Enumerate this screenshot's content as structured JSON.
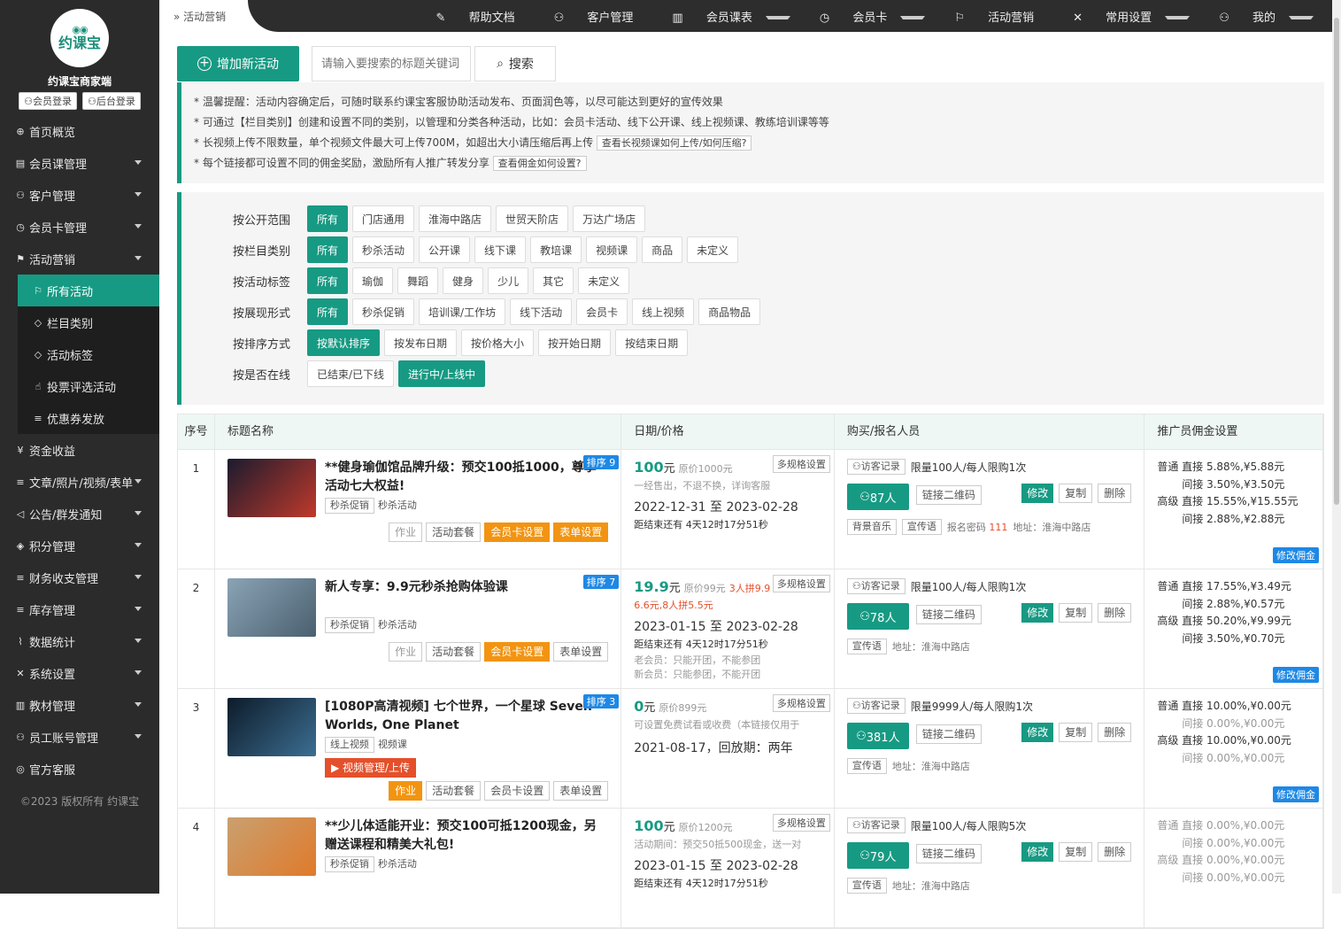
{
  "sidebar": {
    "logo_text": "约课宝",
    "brand": "约课宝商家端",
    "member_login": "会员登录",
    "admin_login": "后台登录",
    "menu": [
      {
        "label": "首页概览",
        "icon": "globe-icon",
        "glyph": "⊕",
        "caret": false
      },
      {
        "label": "会员课管理",
        "icon": "document-icon",
        "glyph": "▤",
        "caret": true
      },
      {
        "label": "客户管理",
        "icon": "user-icon",
        "glyph": "⚇",
        "caret": true
      },
      {
        "label": "会员卡管理",
        "icon": "clock-icon",
        "glyph": "◷",
        "caret": true
      },
      {
        "label": "活动营销",
        "icon": "flag-icon",
        "glyph": "⚑",
        "caret": true
      }
    ],
    "submenu": [
      {
        "label": "所有活动",
        "icon": "flag-icon",
        "glyph": "⚐",
        "active": true
      },
      {
        "label": "栏目类别",
        "icon": "tag-icon",
        "glyph": "◇",
        "active": false
      },
      {
        "label": "活动标签",
        "icon": "tag-icon",
        "glyph": "◇",
        "active": false
      },
      {
        "label": "投票评选活动",
        "icon": "thumb-icon",
        "glyph": "☝",
        "active": false
      },
      {
        "label": "优惠券发放",
        "icon": "sliders-icon",
        "glyph": "≡",
        "active": false
      }
    ],
    "menu2": [
      {
        "label": "资金收益",
        "icon": "yen-icon",
        "glyph": "¥",
        "caret": false
      },
      {
        "label": "文章/照片/视频/表单",
        "icon": "sliders-icon",
        "glyph": "≡",
        "caret": true
      },
      {
        "label": "公告/群发通知",
        "icon": "speaker-icon",
        "glyph": "◁",
        "caret": true
      },
      {
        "label": "积分管理",
        "icon": "diamond-icon",
        "glyph": "◈",
        "caret": true
      },
      {
        "label": "财务收支管理",
        "icon": "sliders-icon",
        "glyph": "≡",
        "caret": true
      },
      {
        "label": "库存管理",
        "icon": "sliders-icon",
        "glyph": "≡",
        "caret": true
      },
      {
        "label": "数据统计",
        "icon": "pulse-icon",
        "glyph": "⌇",
        "caret": true
      },
      {
        "label": "系统设置",
        "icon": "tools-icon",
        "glyph": "✕",
        "caret": true
      },
      {
        "label": "教材管理",
        "icon": "book-icon",
        "glyph": "▥",
        "caret": true
      },
      {
        "label": "员工账号管理",
        "icon": "user-icon",
        "glyph": "⚇",
        "caret": true
      },
      {
        "label": "官方客服",
        "icon": "shield-icon",
        "glyph": "◎",
        "caret": false
      }
    ],
    "copyright": "©2023 版权所有 约课宝"
  },
  "topbar": {
    "breadcrumb": "活动营销",
    "nav": [
      {
        "label": "帮助文档",
        "icon": "help-icon",
        "glyph": "✎",
        "help": true,
        "caret": false
      },
      {
        "label": "客户管理",
        "icon": "user-icon",
        "glyph": "⚇",
        "help": false,
        "caret": false
      },
      {
        "label": "会员课表",
        "icon": "book-icon",
        "glyph": "▥",
        "help": false,
        "caret": true
      },
      {
        "label": "会员卡",
        "icon": "clock-icon",
        "glyph": "◷",
        "help": false,
        "caret": true
      },
      {
        "label": "活动营销",
        "icon": "flag-icon",
        "glyph": "⚐",
        "help": false,
        "caret": false
      },
      {
        "label": "常用设置",
        "icon": "tools-icon",
        "glyph": "✕",
        "help": false,
        "caret": true
      },
      {
        "label": "我的",
        "icon": "user-icon",
        "glyph": "⚇",
        "help": false,
        "caret": true
      }
    ]
  },
  "toolbar": {
    "add_label": "增加新活动",
    "search_placeholder": "请输入要搜索的标题关键词",
    "search_label": "搜索"
  },
  "notice": {
    "lines": [
      {
        "text": "* 温馨提醒：活动内容确定后，可随时联系约课宝客服协助活动发布、页面润色等，以尽可能达到更好的宣传效果",
        "link": ""
      },
      {
        "text": "* 可通过【栏目类别】创建和设置不同的类别，以管理和分类各种活动，比如：会员卡活动、线下公开课、线上视频课、教练培训课等等",
        "link": ""
      },
      {
        "text": "* 长视频上传不限数量，单个视频文件最大可上传700M，如超出大小请压缩后再上传",
        "link": "查看长视频课如何上传/如何压缩?"
      },
      {
        "text": "* 每个链接都可设置不同的佣金奖励，激励所有人推广转发分享",
        "link": "查看佣金如何设置?"
      }
    ]
  },
  "filters": [
    {
      "label": "按公开范围",
      "options": [
        "所有",
        "门店通用",
        "淮海中路店",
        "世贸天阶店",
        "万达广场店"
      ],
      "active": 0
    },
    {
      "label": "按栏目类别",
      "options": [
        "所有",
        "秒杀活动",
        "公开课",
        "线下课",
        "教培课",
        "视频课",
        "商品",
        "未定义"
      ],
      "active": 0
    },
    {
      "label": "按活动标签",
      "options": [
        "所有",
        "瑜伽",
        "舞蹈",
        "健身",
        "少儿",
        "其它",
        "未定义"
      ],
      "active": 0
    },
    {
      "label": "按展现形式",
      "options": [
        "所有",
        "秒杀促销",
        "培训课/工作坊",
        "线下活动",
        "会员卡",
        "线上视频",
        "商品物品"
      ],
      "active": 0
    },
    {
      "label": "按排序方式",
      "options": [
        "按默认排序",
        "按发布日期",
        "按价格大小",
        "按开始日期",
        "按结束日期"
      ],
      "active": 0
    },
    {
      "label": "按是否在线",
      "options": [
        "已结束/已下线",
        "进行中/上线中"
      ],
      "active": 1
    }
  ],
  "table": {
    "headers": [
      "序号",
      "标题名称",
      "日期/价格",
      "购买/报名人员",
      "推广员佣金设置"
    ],
    "spec_label": "多规格设置",
    "visitor_label": "访客记录",
    "qr_label": "链接二维码",
    "edit_label": "修改",
    "copy_label": "复制",
    "delete_label": "删除",
    "mod_comm_label": "修改佣金",
    "rows": [
      {
        "no": "1",
        "title": "**健身瑜伽馆品牌升级：预交100抵1000，尊享活动七大权益!",
        "rank": "排序 9",
        "thumb": [
          "#1b1b2e",
          "#c0392b"
        ],
        "tags": [
          "秒杀促销"
        ],
        "plain": "秒杀活动",
        "video_btn": "",
        "ops": [
          {
            "l": "作业",
            "t": "gray"
          },
          {
            "l": "活动套餐",
            "t": ""
          },
          {
            "l": "会员卡设置",
            "t": "org"
          },
          {
            "l": "表单设置",
            "t": "org"
          }
        ],
        "price": "100",
        "unit": "元",
        "orig": "原价1000元",
        "promo": "",
        "sub": "一经售出，不退不换，详询客服",
        "dates": "2022-12-31 至 2023-02-28",
        "countdown": "距结束还有 4天12时17分51秒",
        "note1": "",
        "note2": "",
        "limit": "限量100人/每人限购1次",
        "people": "87人",
        "extra": [
          "背景音乐",
          "宣传语"
        ],
        "pwd_label": "报名密码",
        "pwd": "111",
        "addr": "地址：淮海中路店",
        "comm": {
          "l1": "普通 直接 5.88%,¥5.88元",
          "l2": "间接 3.50%,¥3.50元",
          "l3": "高级 直接 15.55%,¥15.55元",
          "l4": "间接 2.88%,¥2.88元"
        }
      },
      {
        "no": "2",
        "title": "新人专享：9.9元秒杀抢购体验课",
        "rank": "排序 7",
        "thumb": [
          "#8aa3b5",
          "#4a6070"
        ],
        "tags": [
          "秒杀促销"
        ],
        "plain": "秒杀活动",
        "video_btn": "",
        "ops": [
          {
            "l": "作业",
            "t": "gray"
          },
          {
            "l": "活动套餐",
            "t": ""
          },
          {
            "l": "会员卡设置",
            "t": "org"
          },
          {
            "l": "表单设置",
            "t": ""
          }
        ],
        "price": "19.9",
        "unit": "元",
        "orig": "原价99元",
        "promo": "3人拼9.9",
        "sub": "6.6元,8人拼5.5元",
        "dates": "2023-01-15 至 2023-02-28",
        "countdown": "距结束还有 4天12时17分51秒",
        "note1": "老会员：只能开团，不能参团",
        "note2": "新会员：只能参团，不能开团",
        "limit": "限量100人/每人限购1次",
        "people": "78人",
        "extra": [
          "宣传语"
        ],
        "pwd_label": "",
        "pwd": "",
        "addr": "地址：淮海中路店",
        "comm": {
          "l1": "普通 直接 17.55%,¥3.49元",
          "l2": "间接 2.88%,¥0.57元",
          "l3": "高级 直接 50.20%,¥9.99元",
          "l4": "间接 3.50%,¥0.70元"
        }
      },
      {
        "no": "3",
        "title": "[1080P高清视频] 七个世界，一个星球 Seven Worlds, One Planet",
        "rank": "排序 3",
        "thumb": [
          "#0d1b2a",
          "#3c6e91"
        ],
        "tags": [
          "线上视频"
        ],
        "plain": "视频课",
        "video_btn": "视频管理/上传",
        "ops": [
          {
            "l": "作业",
            "t": "org"
          },
          {
            "l": "活动套餐",
            "t": ""
          },
          {
            "l": "会员卡设置",
            "t": ""
          },
          {
            "l": "表单设置",
            "t": ""
          }
        ],
        "price": "0",
        "unit": "元",
        "orig": "原价899元",
        "promo": "",
        "sub": "可设置免费试看或收费（本链接仅用于",
        "dates": "2021-08-17，回放期：两年",
        "countdown": "",
        "note1": "",
        "note2": "",
        "limit": "限量9999人/每人限购1次",
        "people": "381人",
        "extra": [
          "宣传语"
        ],
        "pwd_label": "",
        "pwd": "",
        "addr": "地址：淮海中路店",
        "comm": {
          "l1": "普通 直接 10.00%,¥0.00元",
          "l2": "间接 0.00%,¥0.00元",
          "l3": "高级 直接 10.00%,¥0.00元",
          "l4": "间接 0.00%,¥0.00元"
        }
      },
      {
        "no": "4",
        "title": "**少儿体适能开业：预交100可抵1200现金，另赠送课程和精美大礼包!",
        "rank": "",
        "thumb": [
          "#c9a070",
          "#e07a2a"
        ],
        "tags": [
          "秒杀促销"
        ],
        "plain": "秒杀活动",
        "video_btn": "",
        "ops": [],
        "price": "100",
        "unit": "元",
        "orig": "原价1200元",
        "promo": "",
        "sub": "活动期间：预交50抵500现金，送一对",
        "dates": "2023-01-15 至 2023-02-28",
        "countdown": "距结束还有 4天12时17分51秒",
        "note1": "",
        "note2": "",
        "limit": "限量100人/每人限购5次",
        "people": "79人",
        "extra": [
          "宣传语"
        ],
        "pwd_label": "",
        "pwd": "",
        "addr": "地址：淮海中路店",
        "comm": {
          "l1": "普通 直接 0.00%,¥0.00元",
          "l2": "间接 0.00%,¥0.00元",
          "l3": "高级 直接 0.00%,¥0.00元",
          "l4": "间接 0.00%,¥0.00元"
        }
      }
    ]
  }
}
